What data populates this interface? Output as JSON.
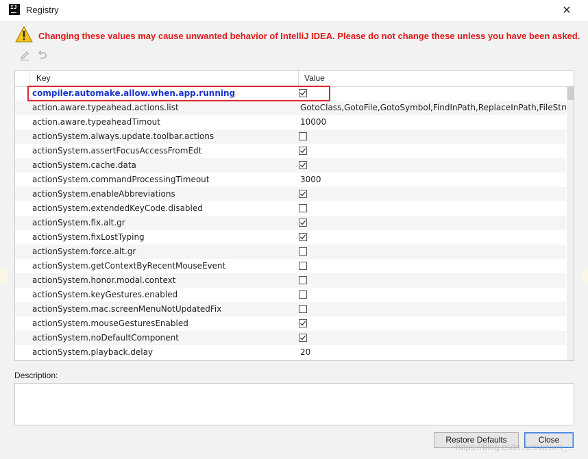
{
  "window": {
    "title": "Registry",
    "app_icon_text": "IJ",
    "close_glyph": "✕"
  },
  "warning": {
    "icon": "warning-triangle-icon",
    "text": "Changing these values may cause unwanted behavior of IntelliJ IDEA. Please do not change these unless you have been asked.",
    "color": "#e01818"
  },
  "toolbar": {
    "edit_icon": "pencil-icon",
    "revert_icon": "undo-icon"
  },
  "table": {
    "headers": {
      "key": "Key",
      "value": "Value"
    },
    "rows": [
      {
        "key": "compiler.automake.allow.when.app.running",
        "type": "checkbox",
        "checked": true,
        "modified": true
      },
      {
        "key": "action.aware.typeahead.actions.list",
        "type": "text",
        "value": "GotoClass,GotoFile,GotoSymbol,FindInPath,ReplaceInPath,FileStruct"
      },
      {
        "key": "action.aware.typeaheadTimout",
        "type": "text",
        "value": "10000"
      },
      {
        "key": "actionSystem.always.update.toolbar.actions",
        "type": "checkbox",
        "checked": false
      },
      {
        "key": "actionSystem.assertFocusAccessFromEdt",
        "type": "checkbox",
        "checked": true
      },
      {
        "key": "actionSystem.cache.data",
        "type": "checkbox",
        "checked": true
      },
      {
        "key": "actionSystem.commandProcessingTimeout",
        "type": "text",
        "value": "3000"
      },
      {
        "key": "actionSystem.enableAbbreviations",
        "type": "checkbox",
        "checked": true
      },
      {
        "key": "actionSystem.extendedKeyCode.disabled",
        "type": "checkbox",
        "checked": false
      },
      {
        "key": "actionSystem.fix.alt.gr",
        "type": "checkbox",
        "checked": true
      },
      {
        "key": "actionSystem.fixLostTyping",
        "type": "checkbox",
        "checked": true
      },
      {
        "key": "actionSystem.force.alt.gr",
        "type": "checkbox",
        "checked": false
      },
      {
        "key": "actionSystem.getContextByRecentMouseEvent",
        "type": "checkbox",
        "checked": false
      },
      {
        "key": "actionSystem.honor.modal.context",
        "type": "checkbox",
        "checked": false
      },
      {
        "key": "actionSystem.keyGestures.enabled",
        "type": "checkbox",
        "checked": false
      },
      {
        "key": "actionSystem.mac.screenMenuNotUpdatedFix",
        "type": "checkbox",
        "checked": false
      },
      {
        "key": "actionSystem.mouseGesturesEnabled",
        "type": "checkbox",
        "checked": true
      },
      {
        "key": "actionSystem.noDefaultComponent",
        "type": "checkbox",
        "checked": true
      },
      {
        "key": "actionSystem.playback.delay",
        "type": "text",
        "value": "20"
      }
    ]
  },
  "description": {
    "label": "Description:",
    "value": ""
  },
  "buttons": {
    "restore": "Restore Defaults",
    "close": "Close"
  },
  "watermark": "https://blog.csdn.net/weixin_..."
}
